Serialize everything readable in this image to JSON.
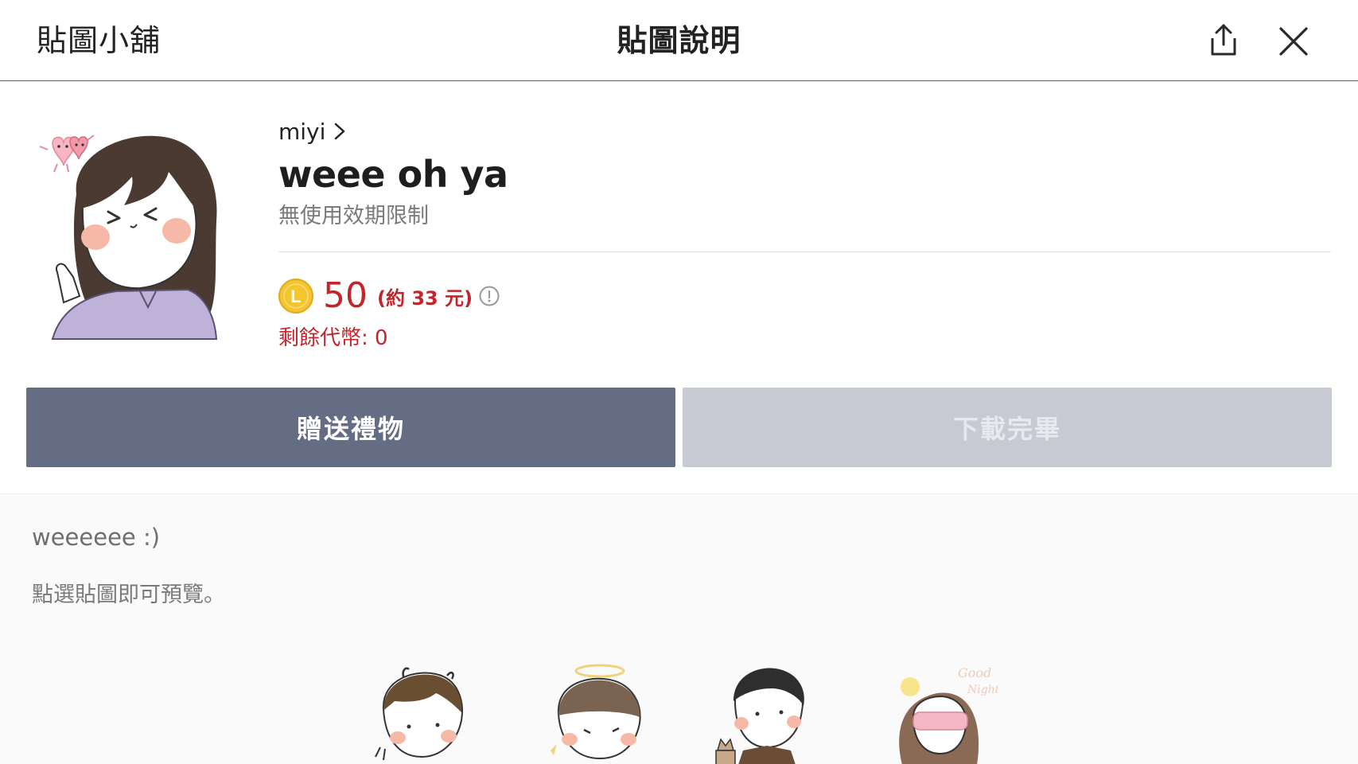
{
  "header": {
    "left_title": "貼圖小舖",
    "center_title": "貼圖說明",
    "share_icon": "share-icon",
    "close_icon": "close-icon"
  },
  "product": {
    "author": "miyi",
    "title": "weee oh ya",
    "validity": "無使用效期限制",
    "coin_letter": "L",
    "price": "50",
    "price_approx": "(約 33 元)",
    "remaining": "剩餘代幣: 0"
  },
  "buttons": {
    "gift": "贈送禮物",
    "download": "下載完畢"
  },
  "description": {
    "text": "weeeeee :)",
    "preview_hint": "點選貼圖即可預覽。"
  },
  "sticker_previews": [
    "boy-devil-sticker",
    "boy-angel-sticker",
    "boy-cat-sticker",
    "girl-goodnight-sticker"
  ],
  "colors": {
    "price_red": "#c2262c",
    "gift_button": "#646d84",
    "download_button": "#c7cad3",
    "coin_gold": "#f2c531"
  }
}
